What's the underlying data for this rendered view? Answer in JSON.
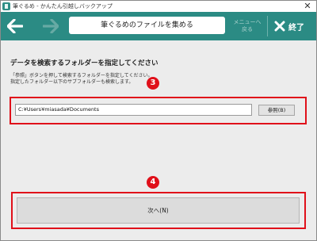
{
  "window": {
    "title": "筆ぐるめ - かんたん引越しバックアップ"
  },
  "toolbar": {
    "page_title": "筆ぐるめのファイルを集める",
    "menu_label_line1": "メニューへ",
    "menu_label_line2": "戻る",
    "exit_label": "終了"
  },
  "content": {
    "heading": "データを検索するフォルダーを指定してください",
    "desc_line1": "「参照」ボタンを押して検索するフォルダーを指定してください。",
    "desc_line2": "指定したフォルダー以下のサブフォルダーも検索します。",
    "folder_path": "C:¥Users¥miasada¥Documents",
    "browse_label": "参照(B)",
    "next_label": "次へ(N)"
  },
  "annotations": {
    "badge3": "3",
    "badge4": "4"
  },
  "colors": {
    "toolbar": "#2b8b84",
    "callout": "#e0101a"
  }
}
